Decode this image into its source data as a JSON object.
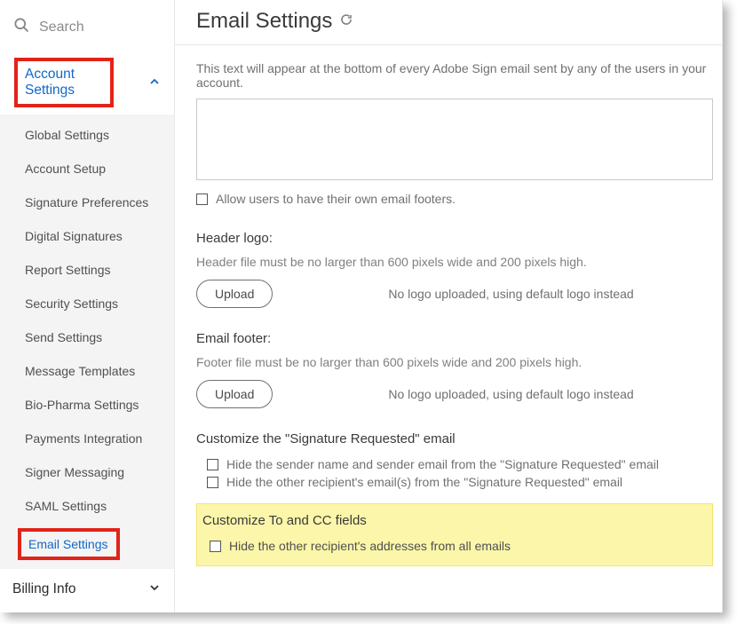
{
  "search": {
    "placeholder": "Search"
  },
  "sidebar": {
    "account_label": "Account Settings",
    "billing_label": "Billing Info",
    "items": [
      "Global Settings",
      "Account Setup",
      "Signature Preferences",
      "Digital Signatures",
      "Report Settings",
      "Security Settings",
      "Send Settings",
      "Message Templates",
      "Bio-Pharma Settings",
      "Payments Integration",
      "Signer Messaging",
      "SAML Settings",
      "Email Settings"
    ]
  },
  "page": {
    "title": "Email Settings",
    "footer_desc": "This text will appear at the bottom of every Adobe Sign email sent by any of the users in your account.",
    "allow_own_footer": "Allow users to have their own email footers.",
    "header_logo_label": "Header logo:",
    "header_logo_help": "Header file must be no larger than 600 pixels wide and 200 pixels high.",
    "email_footer_label": "Email footer:",
    "email_footer_help": "Footer file must be no larger than 600 pixels wide and 200 pixels high.",
    "upload_btn": "Upload",
    "no_logo_msg": "No logo uploaded, using default logo instead",
    "customize_sigreq_label": "Customize the \"Signature Requested\" email",
    "hide_sender": "Hide the sender name and sender email from the \"Signature Requested\" email",
    "hide_other_recip": "Hide the other recipient's email(s) from the \"Signature Requested\" email",
    "customize_tocc_label": "Customize To and CC fields",
    "hide_all_recip": "Hide the other recipient's addresses from all emails"
  }
}
